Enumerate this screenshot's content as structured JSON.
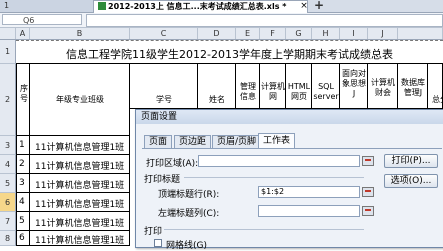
{
  "tabs": [
    {
      "label": "1"
    },
    {
      "label": "2012-2013上 信息工...末考试成绩汇总表.xls *"
    }
  ],
  "tab_close": "×",
  "tab_add": "+",
  "name_box": "Q6",
  "columns": [
    "A",
    "B",
    "C",
    "D",
    "E",
    "F",
    "G",
    "H",
    "I",
    "J"
  ],
  "rows": [
    "1",
    "2",
    "3",
    "4",
    "5",
    "6",
    "7",
    "8"
  ],
  "sheet": {
    "title": "信息工程学院11级学生2012-2013学年度上学期期末考试成绩总表",
    "headers": {
      "seq": "序号",
      "class": "年级专业班级",
      "student_id": "学号",
      "name": "姓名",
      "mgmt": "管理信息",
      "network": "计算机网",
      "html": "HTML网页",
      "sql": "SQL server",
      "oop": "面向对象思想J",
      "acct": "计算机财会",
      "db": "数据库管理J",
      "total": "总分"
    },
    "data_rows": [
      {
        "seq": "1",
        "class": "11计算机信息管理1班"
      },
      {
        "seq": "2",
        "class": "11计算机信息管理1班"
      },
      {
        "seq": "3",
        "class": "11计算机信息管理1班"
      },
      {
        "seq": "4",
        "class": "11计算机信息管理1班"
      },
      {
        "seq": "5",
        "class": "11计算机信息管理1班"
      },
      {
        "seq": "6",
        "class": "11计算机信息管理1班"
      }
    ]
  },
  "dialog": {
    "title": "页面设置",
    "tabs": [
      "页面",
      "页边距",
      "页眉/页脚",
      "工作表"
    ],
    "active_tab": "工作表",
    "print_area_label": "打印区域(A):",
    "print_area_value": "",
    "print_titles_label": "打印标题",
    "top_rows_label": "顶端标题行(R):",
    "top_rows_value": "$1:$2",
    "left_cols_label": "左端标题列(C):",
    "left_cols_value": "",
    "print_section_label": "打印",
    "gridlines_label": "网格线(G)",
    "print_button": "打印(P)...",
    "options_button": "选项(O)..."
  }
}
